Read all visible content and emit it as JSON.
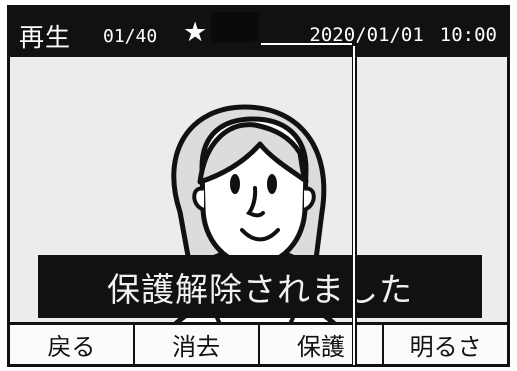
{
  "topbar": {
    "mode": "再生",
    "counter": "01/40",
    "favorite_icon": "star-icon",
    "datetime_date": "2020/01/01",
    "datetime_time": "10:00"
  },
  "portrait": {
    "icon": "person-portrait-icon"
  },
  "message": {
    "text": "保護解除されました"
  },
  "softkeys": [
    {
      "label": "戻る"
    },
    {
      "label": "消去"
    },
    {
      "label": "保護"
    },
    {
      "label": "明るさ"
    }
  ],
  "colors": {
    "bar": "#111111",
    "screen_bg": "#ececec",
    "key_bg": "#fbfbfb"
  }
}
